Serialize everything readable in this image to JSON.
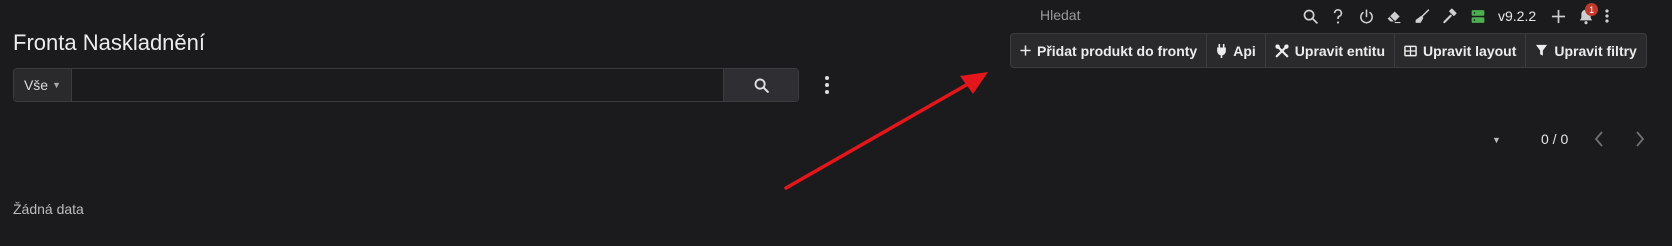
{
  "header": {
    "title": "Fronta Naskladnění",
    "global_search_placeholder": "Hledat",
    "version": "v9.2.2",
    "notification_count": "1"
  },
  "search": {
    "filter_value": "Vše",
    "value": "",
    "placeholder": ""
  },
  "actions": {
    "add_product": "Přidat produkt do fronty",
    "api": "Api",
    "edit_entity": "Upravit entitu",
    "edit_layout": "Upravit layout",
    "edit_filters": "Upravit filtry"
  },
  "pagination": {
    "count": "0 / 0"
  },
  "table": {
    "empty_text": "Žádná data"
  },
  "colors": {
    "background": "#1b1b1d",
    "accent_green": "#4caf50",
    "badge_red": "#c0392b",
    "annotation_arrow": "#e3161b"
  },
  "icons": [
    "search-icon",
    "help-icon",
    "power-icon",
    "eraser-icon",
    "broom-icon",
    "hammer-icon",
    "server-icon",
    "plus-icon",
    "bell-icon",
    "more-vertical-icon",
    "plug-icon",
    "tools-icon",
    "table-icon",
    "filter-icon",
    "chevron-left-icon",
    "chevron-right-icon"
  ]
}
